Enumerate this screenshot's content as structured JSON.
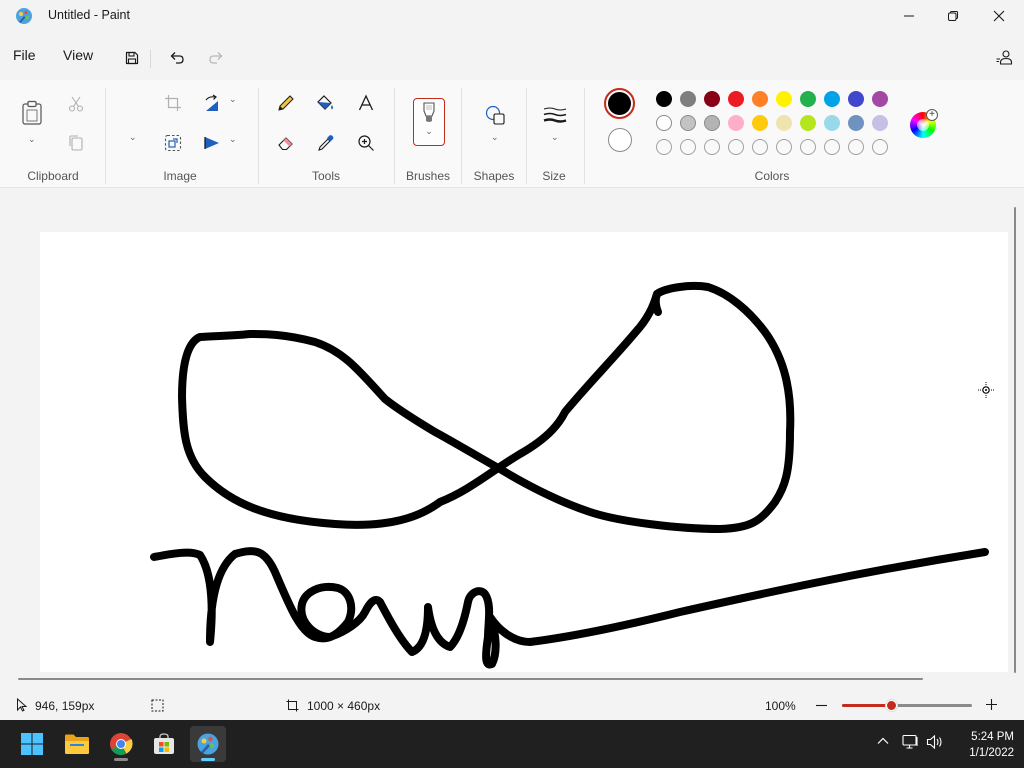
{
  "window": {
    "title": "Untitled - Paint"
  },
  "menu": {
    "file": "File",
    "view": "View"
  },
  "ribbon": {
    "groups": {
      "clipboard": "Clipboard",
      "image": "Image",
      "tools": "Tools",
      "brushes": "Brushes",
      "shapes": "Shapes",
      "size": "Size",
      "colors": "Colors"
    }
  },
  "colors": {
    "primary": "#000000",
    "secondary": "#ffffff",
    "palette_row1": [
      "#000000",
      "#7f7f7f",
      "#880015",
      "#ed1c24",
      "#ff7f27",
      "#fff200",
      "#22b14c",
      "#00a2e8",
      "#3f48cc",
      "#a349a4"
    ],
    "palette_row2": [
      "#ffffff",
      "#c3c3c3",
      "#b4b4b4",
      "#ffaec9",
      "#ffc90e",
      "#efe4b0",
      "#b5e61d",
      "#99d9ea",
      "#7092be",
      "#c8bfe7"
    ],
    "accent": "#c42b1c"
  },
  "status": {
    "cursor_position": "946, 159px",
    "canvas_size": "1000 × 460px",
    "zoom": "100%",
    "zoom_fraction": 0.38
  },
  "taskbar": {
    "apps": [
      "start-icon",
      "file-explorer-icon",
      "chrome-icon",
      "store-icon",
      "paint-icon"
    ],
    "time": "5:24 PM",
    "date": "1/1/2022"
  }
}
